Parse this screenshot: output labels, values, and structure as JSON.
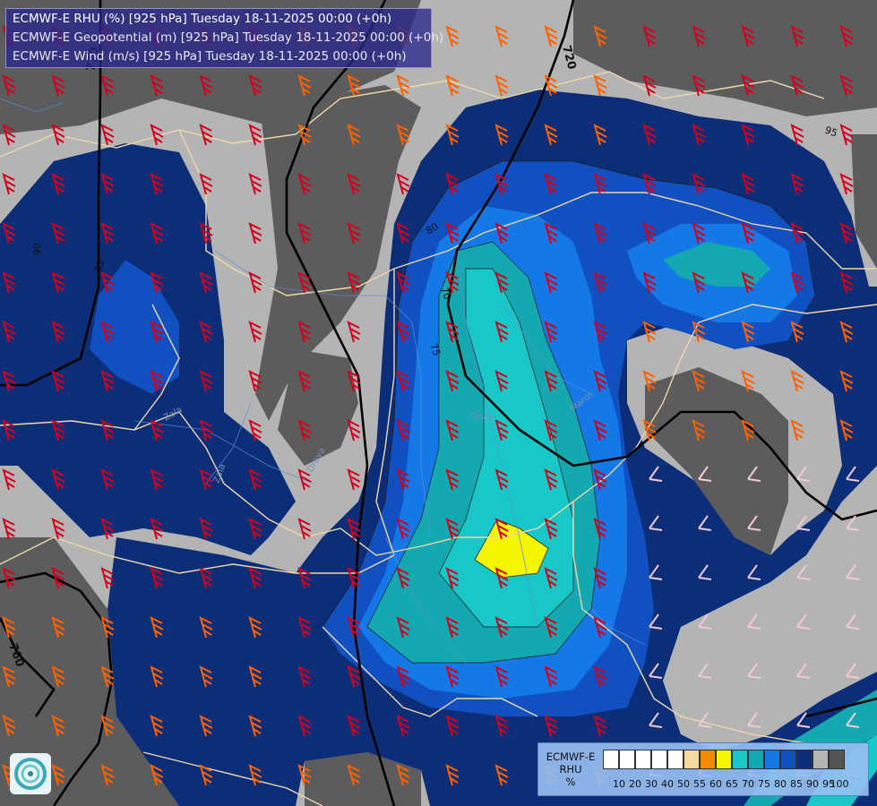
{
  "title": {
    "line1": "ECMWF-E RHU (%) [925 hPa] Tuesday 18-11-2025 00:00 (+0h)",
    "line2": "ECMWF-E Geopotential (m) [925 hPa] Tuesday 18-11-2025 00:00 (+0h)",
    "line3": "ECMWF-E Wind (m/s) [925 hPa] Tuesday 18-11-2025 00:00 (+0h)"
  },
  "legend": {
    "model": "ECMWF-E",
    "variable": "RHU",
    "unit": "%",
    "ticks": [
      "10",
      "20",
      "30",
      "40",
      "50",
      "55",
      "60",
      "65",
      "70",
      "75",
      "80",
      "85",
      "90",
      "95",
      "100"
    ],
    "colors": [
      "#ffffff",
      "#ffffff",
      "#ffffff",
      "#ffffff",
      "#ffffff",
      "#f5d9a0",
      "#f08a00",
      "#f5f500",
      "#18c8c8",
      "#14a8b0",
      "#1478e6",
      "#1050c0",
      "#0c2e78",
      "#b4b4b4",
      "#555555"
    ]
  },
  "contour_labels": {
    "geopotential": [
      "720",
      "760",
      "770"
    ],
    "rhu": [
      "80",
      "85",
      "90",
      "95",
      "70",
      "75"
    ]
  },
  "place_labels": [
    "Zala",
    "Drava",
    "Tisza",
    "Zala",
    "Maros"
  ],
  "colors": {
    "rh95": "#b4b4b4",
    "rh100": "#5c5c5c",
    "rh90": "#0c2e78",
    "rh85": "#1050c0",
    "rh80": "#1478e6",
    "rh75": "#14a8b0",
    "rh70": "#18c8c8",
    "rh65": "#f5f500",
    "border": "#f0d8a8",
    "river": "#5a8fd8"
  },
  "icons": {
    "logo": "ecmwf-swirl-icon"
  }
}
